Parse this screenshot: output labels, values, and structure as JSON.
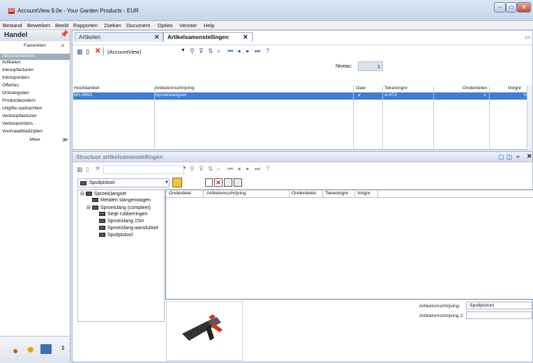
{
  "window": {
    "title": "AccountView 9.0e - Your Garden Products - EUR",
    "app_icon_text": "AV",
    "controls": [
      "minimize-icon",
      "maximize-icon",
      "close-icon"
    ]
  },
  "menu": [
    "Bestand",
    "Bewerken",
    "Beeld",
    "Rapporten",
    "Zoeken",
    "Document",
    "Opties",
    "Venster",
    "Help"
  ],
  "sidebar": {
    "title": "Handel",
    "favorites_label": "Favorieten",
    "selected_item": "Abonnementen",
    "items": [
      "Artikelen",
      "Inkoopfacturen",
      "Inkooporders",
      "Offertes",
      "Ontvangsten",
      "Productieorders",
      "Uitgifte-opdrachten",
      "Verkoopfacturen",
      "Verkooporders",
      "Voorraadbladzijden"
    ],
    "more_label": "Meer"
  },
  "tabs": [
    {
      "label": "Artikelen",
      "active": false
    },
    {
      "label": "Artikelsamenstellingen",
      "active": true
    }
  ],
  "toolbar": {
    "view_select": "(AccountView)",
    "icons": [
      "list-view-icon",
      "new-document-icon",
      "delete-icon",
      "search-icon",
      "filter-icon",
      "sort-icon",
      "find-icon",
      "first-record-icon",
      "previous-record-icon",
      "next-record-icon",
      "last-record-icon",
      "help-icon"
    ]
  },
  "level": {
    "label": "Niveau:",
    "value": "1"
  },
  "main_grid": {
    "columns": [
      "Hoofdartikel",
      "Artikelomschrijving",
      "Oaw",
      "Tekeningnr",
      "Onderdelen",
      "Volgnr"
    ],
    "rows": [
      {
        "Hoofdartikel": "BS-9991",
        "Artikelomschrijving": "Sproeislangset",
        "Oaw": "✔",
        "Tekeningnr": "A-072",
        "Onderdelen": "1",
        "Volgnr": "0"
      }
    ]
  },
  "structure": {
    "title": "Structuur artikelsamenstellingen",
    "selector_value": "Spuitpistool",
    "tree": [
      {
        "label": "Sproeislangset",
        "level": 0
      },
      {
        "label": "Metalen slangenwagen",
        "level": 1
      },
      {
        "label": "Sproeislang (compleet)",
        "level": 1
      },
      {
        "label": "Setje rubberringen",
        "level": 2
      },
      {
        "label": "Sproeislang 15m",
        "level": 2
      },
      {
        "label": "Sproeislang-aansluitset",
        "level": 2
      },
      {
        "label": "Spuitpistool",
        "level": 2
      }
    ],
    "grid_columns": [
      "Onderdeel",
      "Artikelomschrijving",
      "Onderdelen",
      "Tekeningnr",
      "Volgnr"
    ]
  },
  "details": {
    "desc_label": "Artikelomschrijving:",
    "desc_value": "Spuitpistool",
    "desc2_label": "Artikelomschrijving 2:",
    "desc2_value": ""
  }
}
